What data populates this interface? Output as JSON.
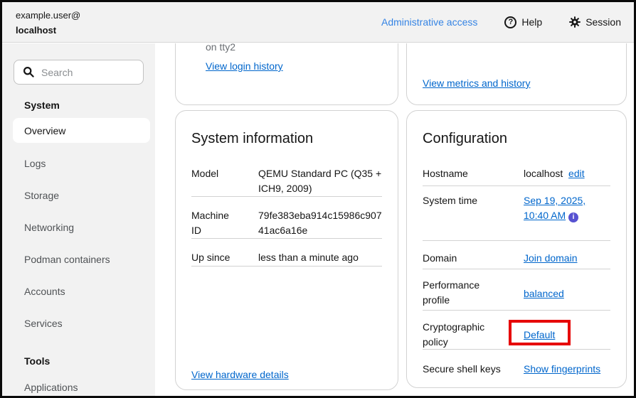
{
  "colors": {
    "link_blue": "#0066cc",
    "masthead_link_blue": "#3584e4",
    "surface_gray": "#f2f2f2",
    "card_border_gray": "#d2d2d2",
    "text_primary": "#151515",
    "text_secondary": "#6a6e73",
    "info_icon_purple": "#5752d1",
    "annotation_red": "#e60000",
    "selected_nav_bg": "#ffffff"
  },
  "masthead": {
    "user_line1": "example.user@",
    "user_line2": "localhost",
    "admin_access_label": "Administrative access",
    "help_label": "Help",
    "help_icon_glyph": "?",
    "session_label": "Session"
  },
  "sidebar": {
    "search_placeholder": "Search",
    "sections": [
      {
        "label": "System",
        "items": [
          {
            "label": "Overview",
            "selected": true
          },
          {
            "label": "Logs"
          },
          {
            "label": "Storage"
          },
          {
            "label": "Networking"
          },
          {
            "label": "Podman containers"
          },
          {
            "label": "Accounts"
          },
          {
            "label": "Services"
          }
        ]
      },
      {
        "label": "Tools",
        "items": [
          {
            "label": "Applications"
          }
        ]
      }
    ]
  },
  "health_card": {
    "login_detail": "on tty2",
    "login_history_link": "View login history"
  },
  "usage_card": {
    "metrics_link": "View metrics and history"
  },
  "system_information": {
    "title": "System information",
    "rows": [
      {
        "label": "Model",
        "value": "QEMU Standard PC (Q35 + ICH9, 2009)"
      },
      {
        "label": "Machine ID",
        "value": "79fe383eba914c15986c90741ac6a16e"
      },
      {
        "label": "Up since",
        "value": "less than a minute ago"
      }
    ],
    "footer_link": "View hardware details"
  },
  "configuration": {
    "title": "Configuration",
    "hostname": {
      "label": "Hostname",
      "value": "localhost",
      "edit_link": "edit"
    },
    "system_time": {
      "label": "System time",
      "value_link": "Sep 19, 2025, 10:40 AM",
      "info_icon_glyph": "i"
    },
    "domain": {
      "label": "Domain",
      "value_link": "Join domain"
    },
    "performance_profile": {
      "label": "Performance profile",
      "value_link": "balanced"
    },
    "cryptographic_policy": {
      "label": "Cryptographic policy",
      "value_link": "Default"
    },
    "secure_shell_keys": {
      "label": "Secure shell keys",
      "value_link": "Show fingerprints"
    }
  }
}
